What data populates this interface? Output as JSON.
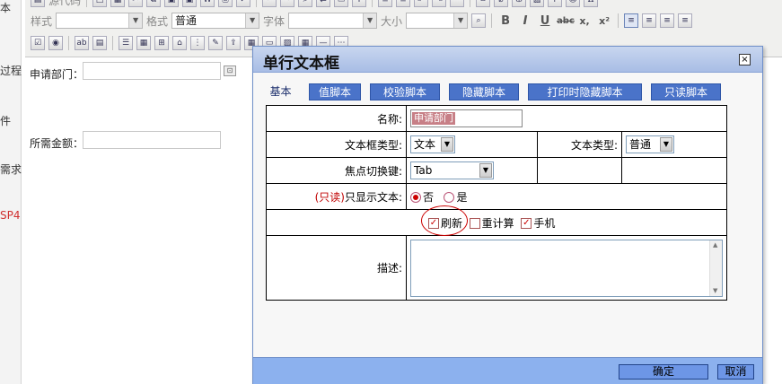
{
  "left_strip": {
    "items": [
      "本",
      "过程",
      "件",
      "需求",
      "SP4"
    ]
  },
  "toolbar": {
    "row1_text": "源代码",
    "style_label": "样式",
    "format_label": "格式",
    "format_value": "普通",
    "font_label": "字体",
    "size_label": "大小",
    "bold": "B",
    "italic": "I",
    "underline": "U",
    "strike": "abc",
    "subscript": "x,",
    "superscript": "x²"
  },
  "bg_form": {
    "department_label": "申请部门：",
    "amount_label": "所需金额："
  },
  "dialog": {
    "title": "单行文本框",
    "close_glyph": "×",
    "tabs": [
      "基本",
      "值脚本",
      "校验脚本",
      "隐藏脚本",
      "打印时隐藏脚本",
      "只读脚本"
    ],
    "fields": {
      "name_label": "名称:",
      "name_value": "申请部门",
      "textbox_type_label": "文本框类型:",
      "textbox_type_value": "文本",
      "text_type_label": "文本类型:",
      "text_type_value": "普通",
      "focus_key_label": "焦点切换键:",
      "focus_key_value": "Tab",
      "readonly_prefix": "(只读)",
      "readonly_label": "只显示文本:",
      "readonly_no": "否",
      "readonly_yes": "是",
      "refresh_label": "刷新",
      "recalc_label": "重计算",
      "mobile_label": "手机",
      "desc_label": "描述:"
    },
    "state": {
      "readonly_selected": "否",
      "refresh_checked": true,
      "recalc_checked": false,
      "mobile_checked": true
    },
    "footer": {
      "ok": "确定",
      "cancel": "取消"
    }
  },
  "colors": {
    "title_bar": "#b7c8eb",
    "footer": "#8cb1ee",
    "tab_button": "#4a73c9",
    "highlight_red": "#c00000"
  }
}
